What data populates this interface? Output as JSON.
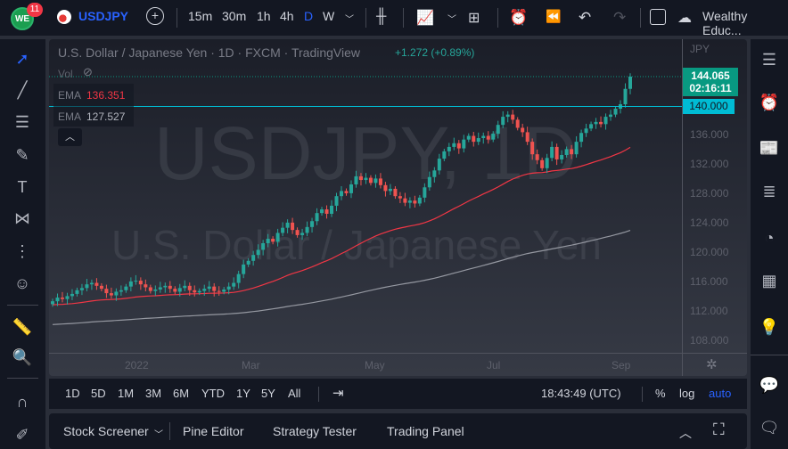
{
  "topbar": {
    "notification_count": "11",
    "symbol": "USDJPY",
    "intervals": [
      "15m",
      "30m",
      "1h",
      "4h",
      "D",
      "W"
    ],
    "active_interval": "D",
    "layout_name": "Wealthy Educ..."
  },
  "legend": {
    "title": "U.S. Dollar / Japanese Yen · 1D · FXCM · TradingView",
    "change": "+1.272 (+0.89%)",
    "vol_label": "Vol",
    "ema1_label": "EMA",
    "ema1_value": "136.351",
    "ema2_label": "EMA",
    "ema2_value": "127.527"
  },
  "watermark": {
    "symbol": "USDJPY, 1D",
    "description": "U.S. Dollar / Japanese Yen"
  },
  "price_scale": {
    "currency": "JPY",
    "last_price": "144.065",
    "countdown": "02:16:11",
    "hline_price": "140.000",
    "ticks": [
      "136.000",
      "132.000",
      "128.000",
      "124.000",
      "120.000",
      "116.000",
      "112.000",
      "108.000"
    ]
  },
  "time_axis": {
    "labels": [
      "2022",
      "Mar",
      "May",
      "Jul",
      "Sep"
    ]
  },
  "range_bar": {
    "ranges": [
      "1D",
      "5D",
      "1M",
      "3M",
      "6M",
      "YTD",
      "1Y",
      "5Y",
      "All"
    ],
    "clock": "18:43:49 (UTC)",
    "percent": "%",
    "log": "log",
    "auto": "auto"
  },
  "footer": {
    "tabs": [
      "Stock Screener",
      "Pine Editor",
      "Strategy Tester",
      "Trading Panel"
    ]
  },
  "colors": {
    "up": "#26a69a",
    "down": "#ef5350",
    "ema_fast": "#f23645",
    "ema_slow": "#9598a1",
    "hline": "#00bcd4",
    "accent": "#2962ff"
  },
  "chart_data": {
    "type": "candlestick",
    "ylim": [
      106,
      146
    ],
    "hline": 140,
    "ema_fast_seed": 113.0,
    "ema_fast_period": 50,
    "ema_slow_seed": 110.3,
    "ema_slow_period": 200,
    "closes": [
      113.5,
      114.0,
      113.8,
      114.2,
      114.5,
      115.0,
      115.3,
      115.8,
      116.0,
      115.6,
      115.2,
      114.6,
      114.3,
      114.8,
      115.0,
      115.5,
      116.2,
      116.3,
      115.8,
      115.4,
      114.9,
      115.1,
      115.4,
      115.6,
      115.2,
      114.8,
      115.3,
      115.6,
      115.0,
      114.7,
      114.9,
      115.2,
      115.5,
      114.9,
      114.8,
      115.1,
      115.5,
      116.0,
      117.2,
      118.5,
      119.0,
      119.8,
      120.5,
      121.4,
      122.0,
      121.6,
      122.8,
      123.5,
      124.2,
      123.2,
      122.5,
      122.8,
      123.6,
      124.4,
      125.5,
      126.0,
      125.4,
      126.5,
      127.8,
      128.5,
      128.2,
      129.4,
      130.5,
      130.0,
      130.3,
      129.6,
      130.2,
      129.3,
      128.5,
      128.8,
      127.8,
      127.5,
      126.9,
      127.2,
      126.8,
      127.6,
      129.0,
      130.4,
      131.3,
      132.9,
      133.9,
      134.5,
      135.0,
      134.3,
      135.5,
      136.0,
      135.2,
      135.7,
      136.0,
      135.5,
      136.3,
      137.5,
      138.6,
      138.9,
      138.2,
      137.1,
      136.5,
      135.2,
      133.5,
      132.7,
      131.6,
      133.0,
      134.5,
      132.8,
      133.4,
      134.2,
      133.5,
      135.2,
      136.4,
      137.0,
      137.6,
      137.9,
      137.6,
      138.6,
      138.9,
      139.7,
      140.3,
      142.4,
      144.065
    ]
  }
}
